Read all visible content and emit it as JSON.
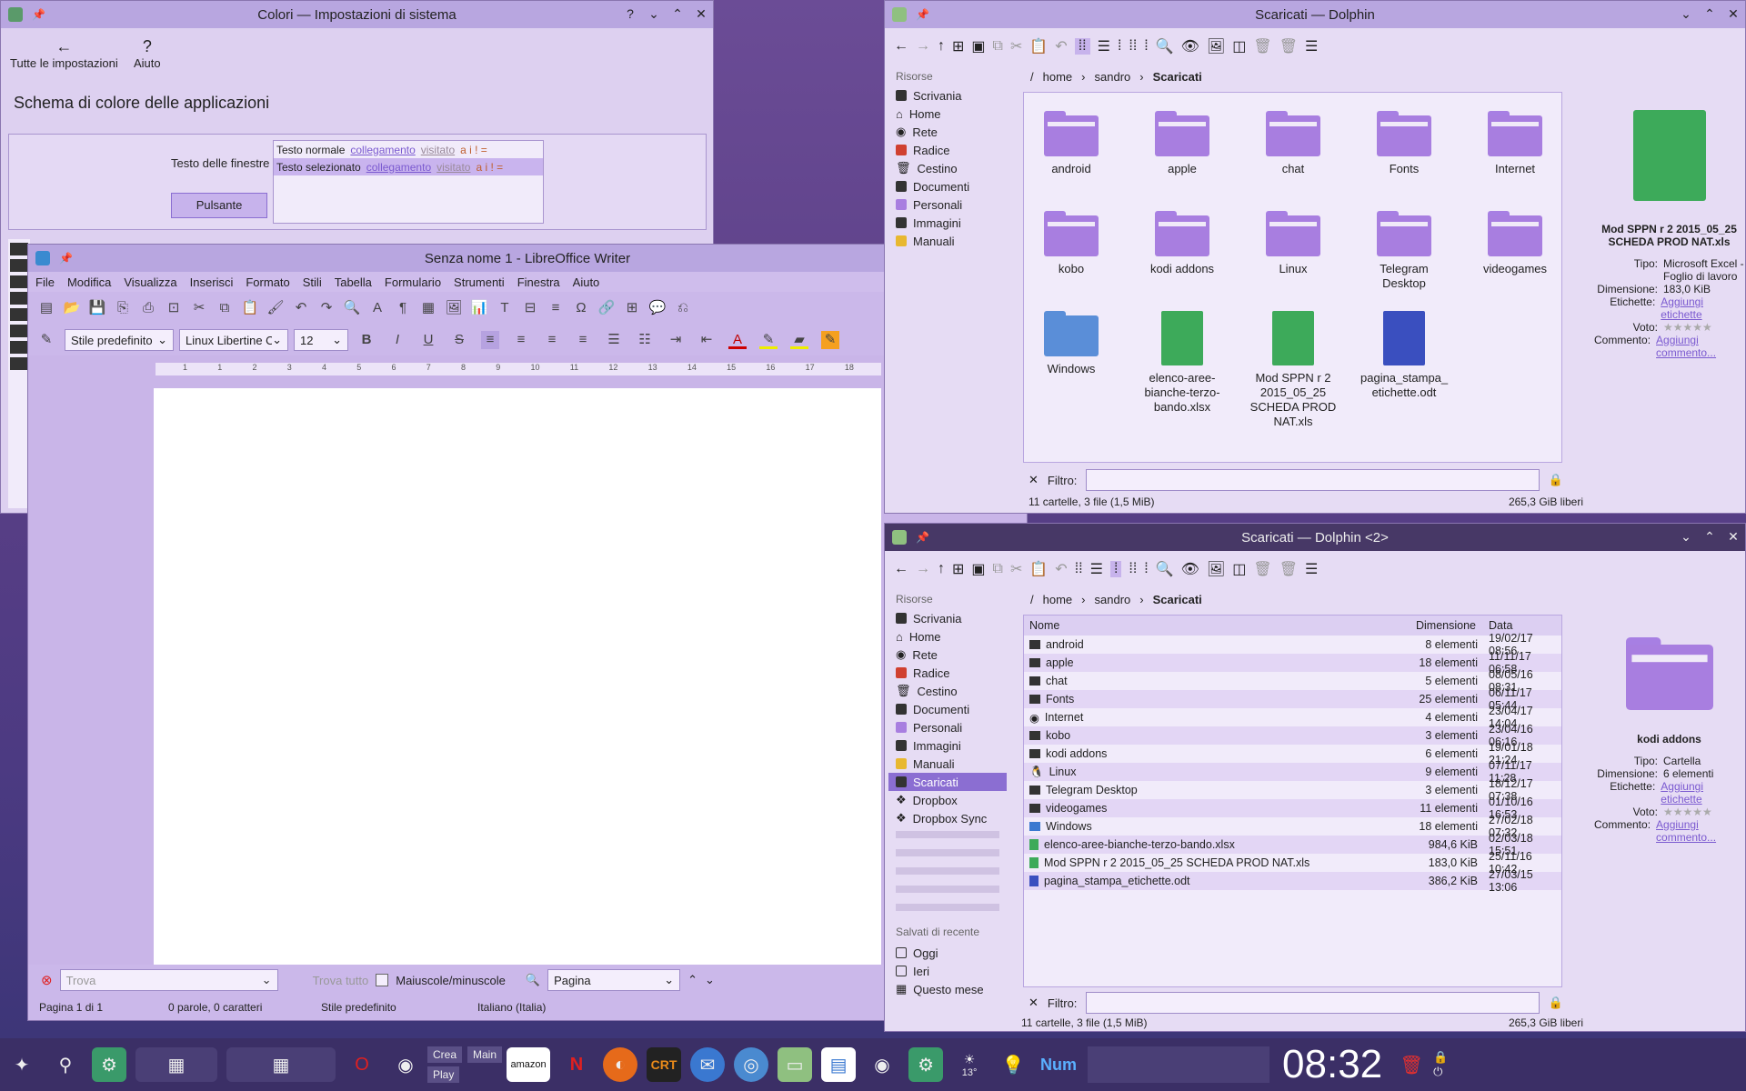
{
  "colors": {
    "accent": "#8b6ed2",
    "titlebar": "#b8a6e0",
    "panel": "#e6dcf4",
    "folder": "#a87ee0",
    "desktop": "#5a3f86"
  },
  "settings": {
    "title": "Colori — Impostazioni di sistema",
    "back_label": "Tutte le impostazioni",
    "help_label": "Aiuto",
    "heading": "Schema di colore delle applicazioni",
    "preview_label": "Testo delle finestre",
    "preview_button": "Pulsante",
    "preview_rows": [
      {
        "text": "Testo normale",
        "link": "collegamento",
        "visited": "visitato",
        "marks": "a i ! ="
      },
      {
        "text": "Testo selezionato",
        "link": "collegamento",
        "visited": "visitato",
        "marks": "a i ! ="
      }
    ]
  },
  "writer": {
    "title": "Senza nome 1 - LibreOffice Writer",
    "menu": [
      "File",
      "Modifica",
      "Visualizza",
      "Inserisci",
      "Formato",
      "Stili",
      "Tabella",
      "Formulario",
      "Strumenti",
      "Finestra",
      "Aiuto"
    ],
    "style": "Stile predefinito",
    "font": "Linux Libertine O",
    "size": "12",
    "ruler": [
      "1",
      "1",
      "2",
      "3",
      "4",
      "5",
      "6",
      "7",
      "8",
      "9",
      "10",
      "11",
      "12",
      "13",
      "14",
      "15",
      "16",
      "17",
      "18"
    ],
    "find_placeholder": "Trova",
    "find_all": "Trova tutto",
    "match_case": "Maiuscole/minuscole",
    "search_scope": "Pagina",
    "status": {
      "page": "Pagina 1 di 1",
      "words": "0 parole, 0 caratteri",
      "style": "Stile predefinito",
      "lang": "Italiano (Italia)"
    }
  },
  "dolphin1": {
    "title": "Scaricati — Dolphin",
    "places_header": "Risorse",
    "places": [
      "Scrivania",
      "Home",
      "Rete",
      "Radice",
      "Cestino",
      "Documenti",
      "Personali",
      "Immagini",
      "Manuali"
    ],
    "breadcrumb": [
      "/",
      "home",
      "sandro",
      "Scaricati"
    ],
    "items": [
      {
        "name": "android",
        "type": "folder"
      },
      {
        "name": "apple",
        "type": "folder"
      },
      {
        "name": "chat",
        "type": "folder"
      },
      {
        "name": "Fonts",
        "type": "folder"
      },
      {
        "name": "Internet",
        "type": "folder"
      },
      {
        "name": "kobo",
        "type": "folder"
      },
      {
        "name": "kodi addons",
        "type": "folder"
      },
      {
        "name": "Linux",
        "type": "folder"
      },
      {
        "name": "Telegram Desktop",
        "type": "folder"
      },
      {
        "name": "videogames",
        "type": "folder"
      },
      {
        "name": "Windows",
        "type": "folder"
      },
      {
        "name": "elenco-aree-bianche-terzo-bando.xlsx",
        "type": "sheet"
      },
      {
        "name": "Mod SPPN r 2 2015_05_25 SCHEDA PROD NAT.xls",
        "type": "sheet"
      },
      {
        "name": "pagina_stampa_etichette.odt",
        "type": "doc"
      }
    ],
    "labels": [
      "android",
      "apple",
      "chat",
      "Fonts",
      "Internet",
      "kobo",
      "kodi addons",
      "Linux",
      "Telegram Desktop",
      "videogames",
      "Windows",
      "elenco-aree-\nbianche-terzo-\nbando.xlsx",
      "Mod SPPN r 2\n2015_05_25\nSCHEDA PROD\nNAT.xls",
      "pagina_stampa_\netichette.odt"
    ],
    "filter_label": "Filtro:",
    "status": "11 cartelle, 3 file (1,5 MiB)",
    "free": "265,3 GiB liberi",
    "info": {
      "name": "Mod SPPN r 2 2015_05_25 SCHEDA PROD NAT.xls",
      "tipo_k": "Tipo:",
      "tipo": "Microsoft Excel - Foglio di lavoro",
      "dim_k": "Dimensione:",
      "dim": "183,0 KiB",
      "tag_k": "Etichette:",
      "tag": "Aggiungi etichette",
      "voto_k": "Voto:",
      "comm_k": "Commento:",
      "comm": "Aggiungi commento..."
    }
  },
  "dolphin2": {
    "title": "Scaricati — Dolphin <2>",
    "places_header": "Risorse",
    "places": [
      "Scrivania",
      "Home",
      "Rete",
      "Radice",
      "Cestino",
      "Documenti",
      "Personali",
      "Immagini",
      "Manuali",
      "Scaricati",
      "Dropbox",
      "Dropbox Sync"
    ],
    "recent_header": "Salvati di recente",
    "recent": [
      "Oggi",
      "Ieri",
      "Questo mese"
    ],
    "breadcrumb": [
      "/",
      "home",
      "sandro",
      "Scaricati"
    ],
    "columns": [
      "Nome",
      "Dimensione",
      "Data"
    ],
    "rows": [
      [
        "android",
        "8 elementi",
        "19/02/17 08:56"
      ],
      [
        "apple",
        "18 elementi",
        "11/11/17 06:58"
      ],
      [
        "chat",
        "5 elementi",
        "08/05/16 08:31"
      ],
      [
        "Fonts",
        "25 elementi",
        "06/11/17 05:44"
      ],
      [
        "Internet",
        "4 elementi",
        "23/04/17 14:04"
      ],
      [
        "kobo",
        "3 elementi",
        "23/04/16 06:16"
      ],
      [
        "kodi addons",
        "6 elementi",
        "19/01/18 21:24"
      ],
      [
        "Linux",
        "9 elementi",
        "07/11/17 11:28"
      ],
      [
        "Telegram Desktop",
        "3 elementi",
        "18/12/17 07:38"
      ],
      [
        "videogames",
        "11 elementi",
        "01/10/16 16:53"
      ],
      [
        "Windows",
        "18 elementi",
        "27/02/18 07:32"
      ],
      [
        "elenco-aree-bianche-terzo-bando.xlsx",
        "984,6 KiB",
        "02/03/18 15:51"
      ],
      [
        "Mod SPPN r 2 2015_05_25 SCHEDA PROD NAT.xls",
        "183,0 KiB",
        "25/11/16 10:42"
      ],
      [
        "pagina_stampa_etichette.odt",
        "386,2 KiB",
        "27/03/15 13:06"
      ]
    ],
    "filter_label": "Filtro:",
    "status": "11 cartelle, 3 file (1,5 MiB)",
    "free": "265,3 GiB liberi",
    "info": {
      "name": "kodi addons",
      "tipo_k": "Tipo:",
      "tipo": "Cartella",
      "dim_k": "Dimensione:",
      "dim": "6 elementi",
      "tag_k": "Etichette:",
      "tag": "Aggiungi etichette",
      "voto_k": "Voto:",
      "comm_k": "Commento:",
      "comm": "Aggiungi commento..."
    }
  },
  "taskbar": {
    "crea": "Crea",
    "main": "Main",
    "play": "Play",
    "num": "Num",
    "temp": "13°",
    "clock": "08:32",
    "amazon": "amazon",
    "crt": "CRT"
  }
}
